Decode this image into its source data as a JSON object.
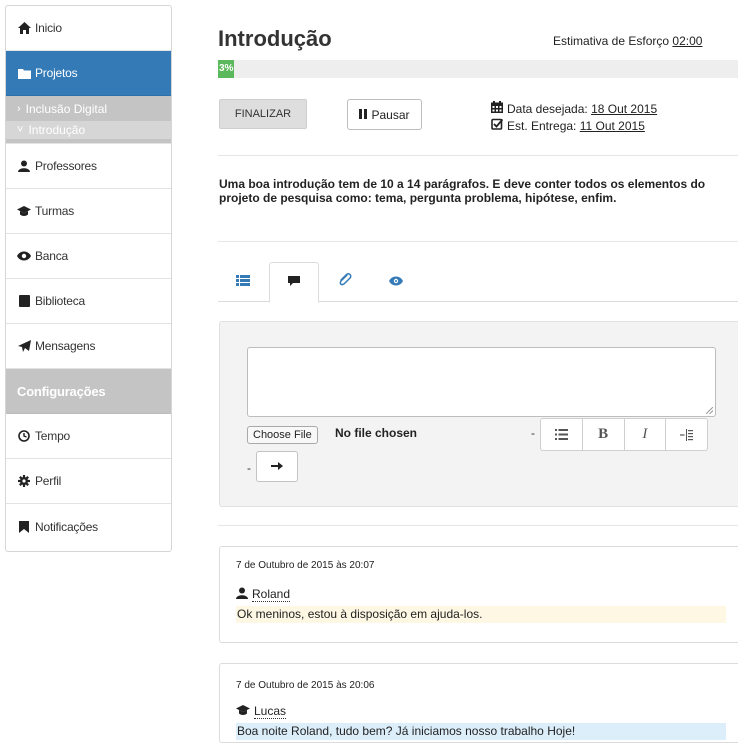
{
  "sidebar": {
    "items": [
      {
        "label": "Inicio",
        "icon": "home-icon"
      },
      {
        "label": "Projetos",
        "icon": "folder-icon",
        "active": true
      },
      {
        "label": "Professores",
        "icon": "user-icon"
      },
      {
        "label": "Turmas",
        "icon": "graduation-cap-icon"
      },
      {
        "label": "Banca",
        "icon": "eye-icon"
      },
      {
        "label": "Biblioteca",
        "icon": "book-icon"
      },
      {
        "label": "Mensagens",
        "icon": "send-icon"
      },
      {
        "label": "Tempo",
        "icon": "clock-icon"
      },
      {
        "label": "Perfil",
        "icon": "gear-icon"
      },
      {
        "label": "Notificações",
        "icon": "bookmark-icon"
      }
    ],
    "subitems": [
      {
        "label": "Inclusão Digital",
        "chevron": "›"
      },
      {
        "label": "Introdução",
        "chevron": "˅"
      }
    ],
    "section_label": "Configurações"
  },
  "header": {
    "title": "Introdução",
    "effort_label": "Estimativa de Esforço ",
    "effort_value": "02:00"
  },
  "progress": {
    "label": "3%",
    "percent": 3,
    "color": "#5cb85c"
  },
  "actions": {
    "finalizar": "FINALIZAR",
    "pausar": "Pausar"
  },
  "dates": {
    "desired_label": "Data desejada: ",
    "desired_value": "18 Out 2015",
    "delivery_label": "Est. Entrega: ",
    "delivery_value": "11 Out 2015"
  },
  "description": "Uma boa introdução tem de 10 a 14 parágrafos. E deve conter todos os elementos do projeto de pesquisa como: tema, pergunta problema, hipótese, enfim.",
  "tabs": [
    {
      "icon": "list-icon"
    },
    {
      "icon": "comment-icon",
      "active": true
    },
    {
      "icon": "paperclip-icon"
    },
    {
      "icon": "eye-icon"
    }
  ],
  "composer": {
    "choose_file": "Choose File",
    "no_file": "No file chosen",
    "dash": "-",
    "tools": [
      "list",
      "B",
      "I",
      "indent"
    ]
  },
  "messages": [
    {
      "date": "7 de Outubro de 2015 às 20:07",
      "author": "Roland",
      "author_icon": "user-icon",
      "text": "Ok meninos, estou à disposição em ajuda-los.",
      "bg": "#fdf7e3"
    },
    {
      "date": "7 de Outubro de 2015 às 20:06",
      "author": "Lucas",
      "author_icon": "graduation-cap-icon",
      "text": "Boa noite Roland, tudo bem? Já iniciamos nosso trabalho Hoje!",
      "bg": "#dceefa"
    }
  ],
  "colors": {
    "accent": "#337ab7",
    "section_bg": "#c4c4c4",
    "success": "#5cb85c"
  }
}
